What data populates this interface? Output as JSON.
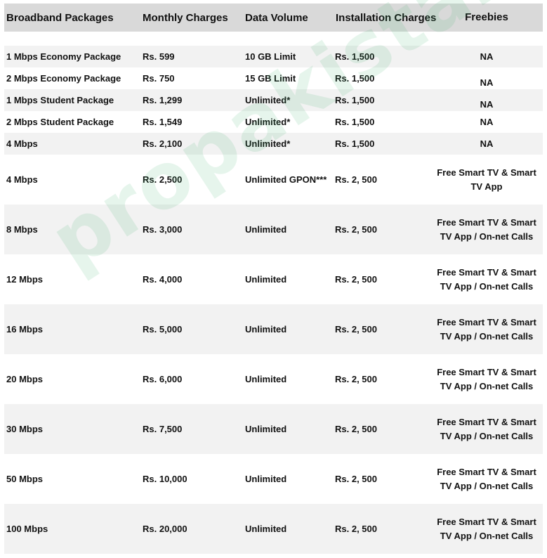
{
  "table": {
    "headers": [
      "Broadband Packages",
      "Monthly Charges",
      "Data Volume",
      "Installation Charges",
      "Freebies"
    ],
    "rows": [
      {
        "package": "1  Mbps Economy Package",
        "monthly": "Rs. 599",
        "data": "10 GB Limit",
        "installation": "Rs. 1,500",
        "freebies": "NA"
      },
      {
        "package": "2 Mbps Economy Package",
        "monthly": "Rs. 750",
        "data": "15 GB Limit",
        "installation": "Rs. 1,500",
        "freebies": "NA"
      },
      {
        "package": "1 Mbps Student Package",
        "monthly": "Rs. 1,299",
        "data": "Unlimited*",
        "installation": "Rs. 1,500",
        "freebies": "NA"
      },
      {
        "package": "2 Mbps Student Package",
        "monthly": "Rs. 1,549",
        "data": "Unlimited*",
        "installation": "Rs. 1,500",
        "freebies": "NA"
      },
      {
        "package": "4 Mbps",
        "monthly": "Rs. 2,100",
        "data": "Unlimited*",
        "installation": "Rs. 1,500",
        "freebies": "NA"
      },
      {
        "package": "4 Mbps",
        "monthly": "Rs. 2,500",
        "data": "Unlimited GPON***",
        "installation": "Rs. 2, 500",
        "freebies": "Free Smart TV & Smart TV App"
      },
      {
        "package": "8 Mbps",
        "monthly": "Rs. 3,000",
        "data": "Unlimited",
        "installation": "Rs. 2, 500",
        "freebies": "Free Smart TV & Smart TV App / On-net Calls"
      },
      {
        "package": "12 Mbps",
        "monthly": "Rs. 4,000",
        "data": "Unlimited",
        "installation": "Rs. 2, 500",
        "freebies": "Free Smart TV & Smart TV App / On-net Calls"
      },
      {
        "package": "16 Mbps",
        "monthly": "Rs. 5,000",
        "data": "Unlimited",
        "installation": "Rs. 2, 500",
        "freebies": "Free Smart TV & Smart TV App / On-net Calls"
      },
      {
        "package": "20 Mbps",
        "monthly": "Rs. 6,000",
        "data": "Unlimited",
        "installation": "Rs. 2, 500",
        "freebies": "Free Smart TV & Smart TV App / On-net Calls"
      },
      {
        "package": "30 Mbps",
        "monthly": "Rs. 7,500",
        "data": "Unlimited",
        "installation": "Rs. 2, 500",
        "freebies": "Free Smart TV & Smart TV App / On-net Calls"
      },
      {
        "package": "50 Mbps",
        "monthly": "Rs. 10,000",
        "data": "Unlimited",
        "installation": "Rs. 2, 500",
        "freebies": "Free Smart TV & Smart TV App / On-net Calls"
      },
      {
        "package": "100 Mbps",
        "monthly": "Rs. 20,000",
        "data": "Unlimited",
        "installation": "Rs. 2, 500",
        "freebies": "Free Smart TV & Smart TV App / On-net Calls"
      }
    ]
  },
  "watermark": "propakistani.pk"
}
